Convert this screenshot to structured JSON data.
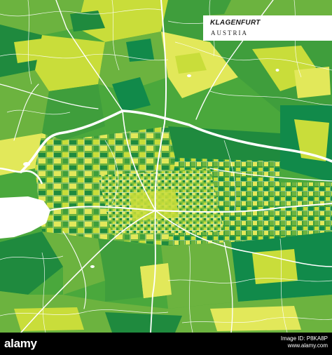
{
  "map": {
    "title": "KLAGENFURT",
    "subtitle": "AUSTRIA",
    "colors": {
      "light_green": "#c9dd3a",
      "yellow_green": "#e2e85a",
      "mid_green": "#6cb33f",
      "green": "#3f9e3c",
      "dark_green": "#1f8a3e",
      "teal_green": "#118a4a",
      "road": "#ffffff",
      "water": "#ffffff"
    },
    "features": [
      "lake-woerthersee",
      "motorway",
      "city-center-street-grid",
      "river-glan"
    ]
  },
  "footer": {
    "logo": "alamy",
    "image_id": "Image ID: P8KA8P",
    "site": "www.alamy.com"
  }
}
